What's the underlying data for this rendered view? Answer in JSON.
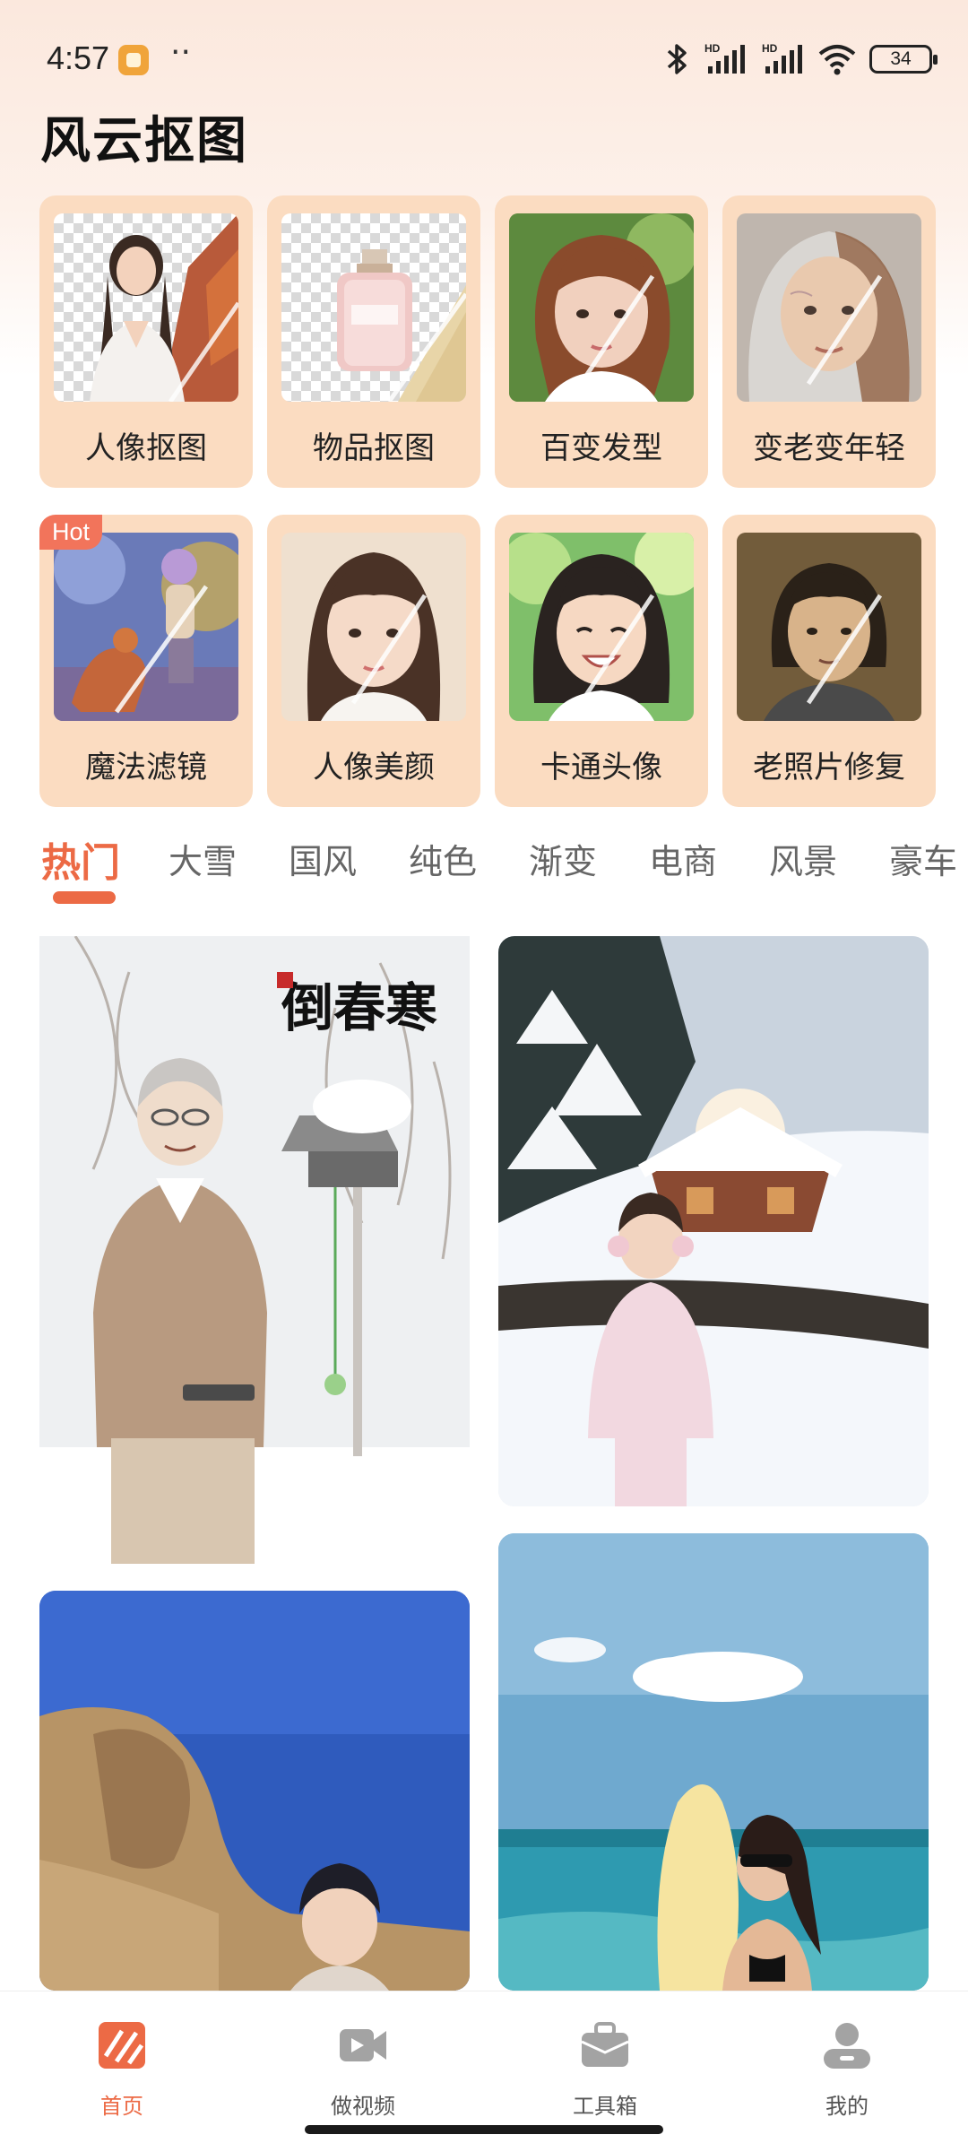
{
  "status_bar": {
    "time": "4:57",
    "more": "··",
    "battery": "34"
  },
  "app": {
    "title": "风云抠图"
  },
  "features": [
    {
      "label": "人像抠图",
      "icon": "portrait-cutout-thumbnail"
    },
    {
      "label": "物品抠图",
      "icon": "object-cutout-thumbnail"
    },
    {
      "label": "百变发型",
      "icon": "hairstyle-thumbnail"
    },
    {
      "label": "变老变年轻",
      "icon": "age-change-thumbnail"
    },
    {
      "label": "魔法滤镜",
      "icon": "magic-filter-thumbnail",
      "badge": "Hot"
    },
    {
      "label": "人像美颜",
      "icon": "beauty-thumbnail"
    },
    {
      "label": "卡通头像",
      "icon": "cartoon-avatar-thumbnail"
    },
    {
      "label": "老照片修复",
      "icon": "old-photo-restore-thumbnail"
    }
  ],
  "tabs": [
    "热门",
    "大雪",
    "国风",
    "纯色",
    "渐变",
    "电商",
    "风景",
    "豪车"
  ],
  "active_tab": "热门",
  "feed": {
    "calligraphy": "倒春寒"
  },
  "bottom_nav": [
    {
      "label": "首页",
      "icon": "home-icon",
      "active": true
    },
    {
      "label": "做视频",
      "icon": "video-camera-icon",
      "active": false
    },
    {
      "label": "工具箱",
      "icon": "toolbox-icon",
      "active": false
    },
    {
      "label": "我的",
      "icon": "profile-icon",
      "active": false
    }
  ],
  "colors": {
    "accent": "#ec6a45",
    "card_bg": "#fbdcc1",
    "hot_badge": "#f2745b"
  }
}
